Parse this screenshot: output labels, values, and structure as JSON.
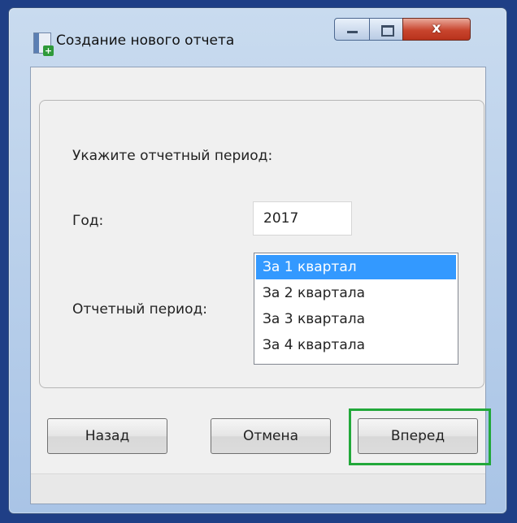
{
  "window": {
    "title": "Создание нового отчета",
    "close_glyph": "x"
  },
  "form": {
    "prompt": "Укажите отчетный период:",
    "year_label": "Год:",
    "year_value": "2017",
    "period_label": "Отчетный период:",
    "period_options": [
      "За 1 квартал",
      "За 2 квартала",
      "За 3 квартала",
      "За 4 квартала"
    ],
    "selected_index": 0
  },
  "buttons": {
    "back": "Назад",
    "cancel": "Отмена",
    "next": "Вперед"
  },
  "colors": {
    "selection": "#3399ff",
    "highlight_frame": "#22a83a"
  }
}
